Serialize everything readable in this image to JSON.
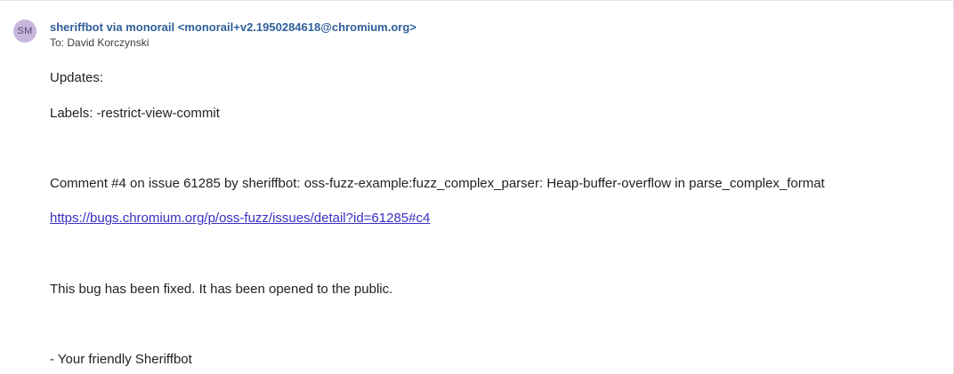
{
  "sender": {
    "initials": "SM",
    "name": "sheriffbot via monorail",
    "address": "<monorail+v2.1950284618@chromium.org>",
    "to_prefix": "To:",
    "to_name": "David Korczynski"
  },
  "message": {
    "updates": "Updates:",
    "labels": "Labels: -restrict-view-commit",
    "comment": "Comment #4 on issue 61285 by sheriffbot: oss-fuzz-example:fuzz_complex_parser: Heap-buffer-overflow in parse_complex_format",
    "link": "https://bugs.chromium.org/p/oss-fuzz/issues/detail?id=61285#c4",
    "fixed": "This bug has been fixed. It has been opened to the public.",
    "signature": "- Your friendly Sheriffbot"
  },
  "colors": {
    "avatar_bg": "#c7b7dd",
    "sender": "#2f5f9a",
    "link": "#3b2ec4"
  }
}
